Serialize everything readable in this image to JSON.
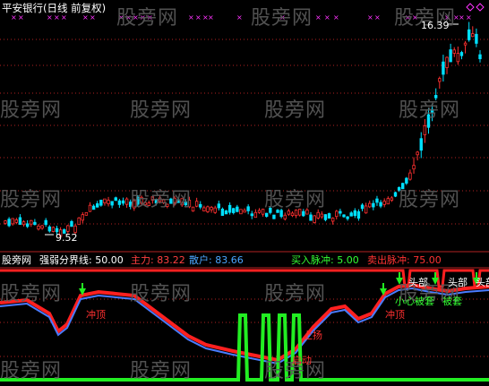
{
  "window": {
    "title": "平安银行(日线 前复权)"
  },
  "watermark": "股旁网",
  "price_panel": {
    "high_label": "16.39",
    "low_label": "9.52"
  },
  "indicator_header": {
    "name": "股旁网",
    "items": [
      {
        "label": "强弱分界线: 50.00",
        "color": "#ffffff"
      },
      {
        "label": "主力: 83.22",
        "color": "#ff4040"
      },
      {
        "label": "散户: 83.66",
        "color": "#4aa6ff"
      },
      {
        "label": "买入脉冲: 5.00",
        "color": "#33ff33"
      },
      {
        "label": "卖出脉冲: 75.00",
        "color": "#ff3333"
      }
    ]
  },
  "annotations": {
    "peak_left": "冲顶",
    "peak_right": "冲顶",
    "rise": "上扬",
    "start": "启动",
    "top1": "头部",
    "top2": "头部",
    "top3": "头部",
    "careful": "小心被套",
    "trapped": "被套"
  },
  "colors": {
    "up_candle": "#ff3030",
    "down_candle": "#00e0ff",
    "main_force": "#ff2020",
    "retail": "#4a7cff",
    "buy_pulse": "#22ee22",
    "sell_pulse": "#ff2020",
    "marker": "#ff33ff"
  }
}
